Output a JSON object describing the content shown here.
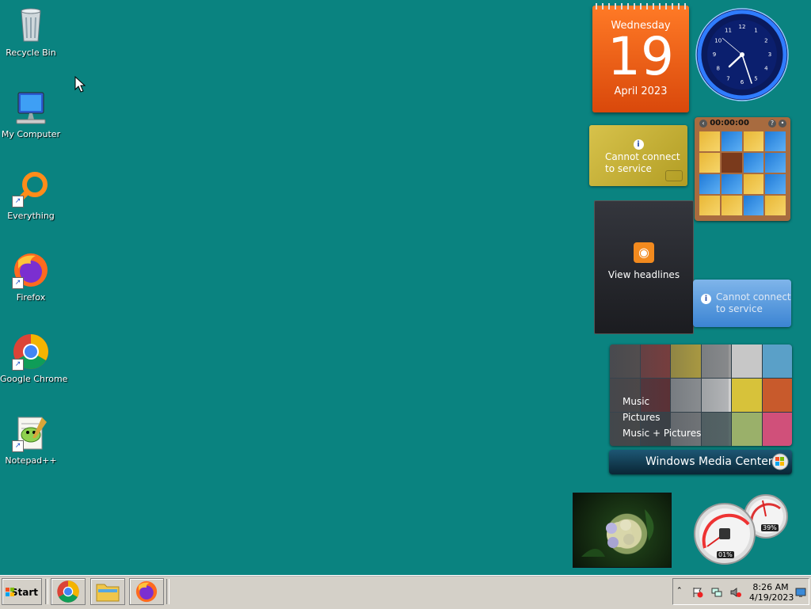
{
  "desktop": {
    "icons": [
      {
        "label": "Recycle Bin"
      },
      {
        "label": "My Computer"
      },
      {
        "label": "Everything"
      },
      {
        "label": "Firefox"
      },
      {
        "label": "Google Chrome"
      },
      {
        "label": "Notepad++"
      }
    ]
  },
  "gadgets": {
    "calendar": {
      "weekday": "Wednesday",
      "day": "19",
      "month_year": "April 2023"
    },
    "clock": {
      "numbers": [
        "12",
        "1",
        "2",
        "3",
        "4",
        "5",
        "6",
        "7",
        "8",
        "9",
        "10",
        "11"
      ]
    },
    "stocks": {
      "message": "Cannot connect to service",
      "line1": "Cannot connect",
      "line2": "to service"
    },
    "puzzle": {
      "timer": "00:00:00"
    },
    "feed": {
      "label": "View headlines"
    },
    "weather": {
      "line1": "Cannot connect",
      "line2": "to service"
    },
    "media_center": {
      "menu": [
        "Music",
        "Pictures",
        "Music + Pictures"
      ],
      "brand": "Windows Media Center"
    },
    "cpu_meter": {
      "cpu": "01%",
      "memory": "39%"
    }
  },
  "taskbar": {
    "start_label": "Start",
    "pinned": [
      "Google Chrome",
      "File Explorer",
      "Firefox"
    ],
    "clock_time": "8:26 AM",
    "clock_date": "4/19/2023"
  },
  "colors": {
    "desktop": "#0a8380",
    "calendar": "#e8601a",
    "taskbar": "#d4d0c8"
  }
}
